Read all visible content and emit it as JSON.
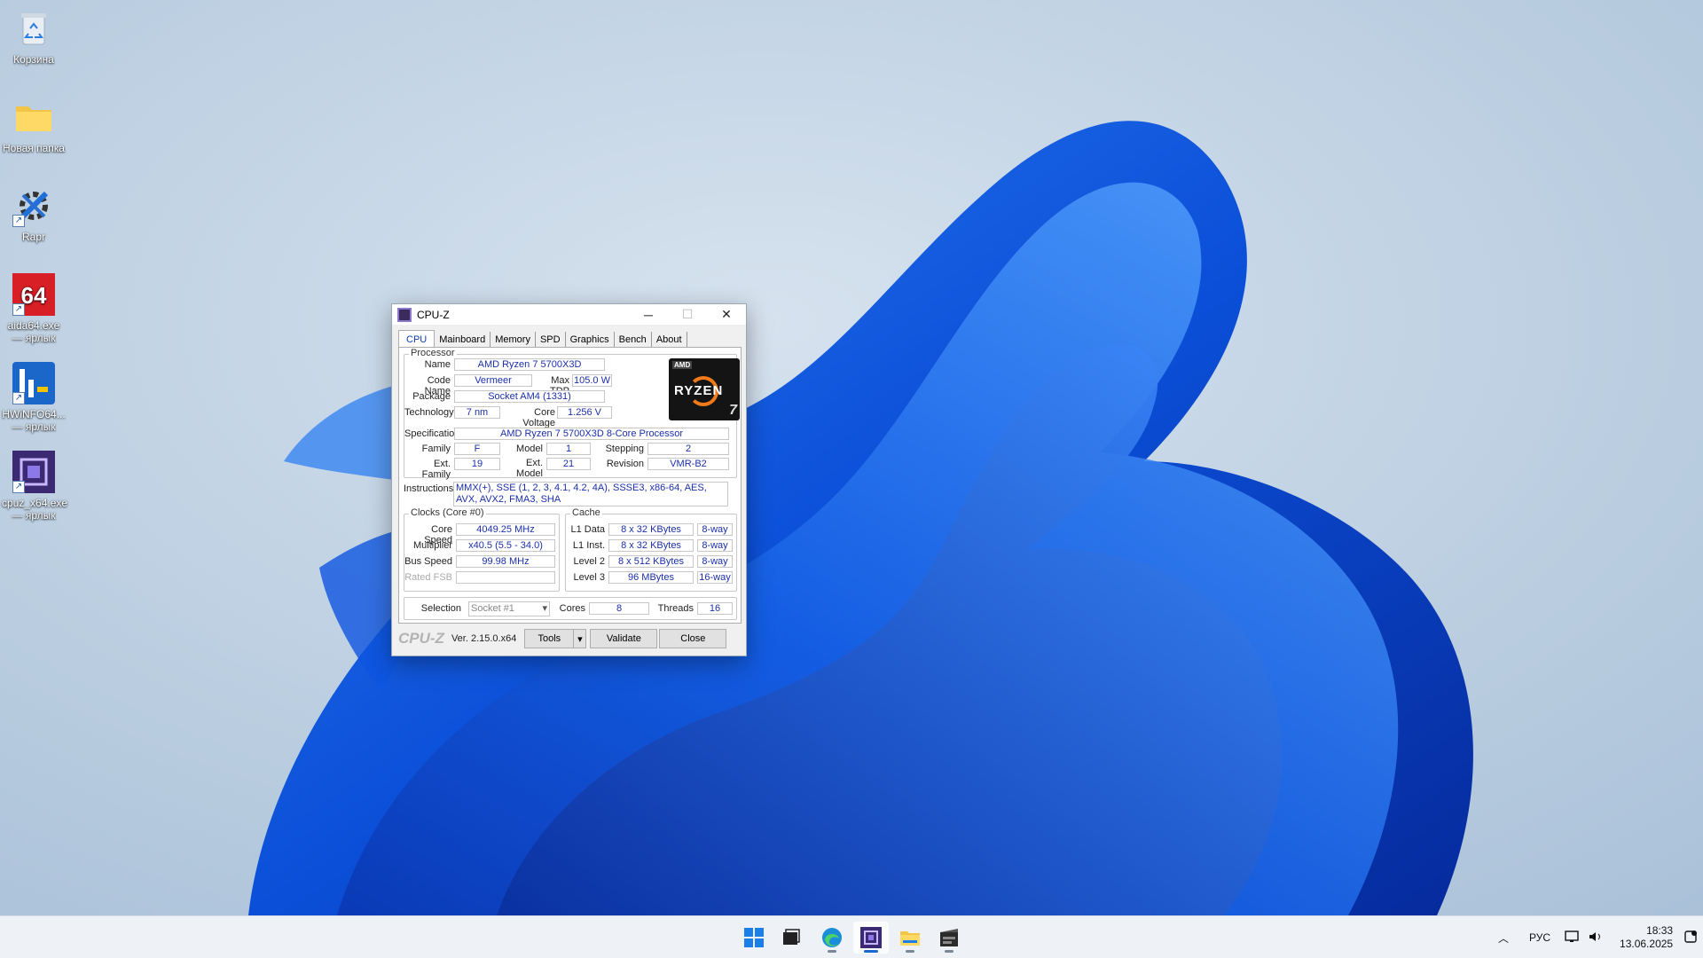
{
  "desktop": {
    "icons": [
      {
        "label": "Корзина",
        "icon": "recycle-bin-icon"
      },
      {
        "label": "Новая папка",
        "icon": "folder-icon"
      },
      {
        "label": "Rapr",
        "icon": "tools-icon"
      },
      {
        "label": "aida64.exe — ярлык",
        "icon": "aida64-icon"
      },
      {
        "label": "HWiNFO64... — ярлык",
        "icon": "hwinfo-icon"
      },
      {
        "label": "cpuz_x64.exe — ярлык",
        "icon": "cpuz-icon"
      }
    ]
  },
  "cpuz": {
    "title": "CPU-Z",
    "tabs": [
      "CPU",
      "Mainboard",
      "Memory",
      "SPD",
      "Graphics",
      "Bench",
      "About"
    ],
    "processor": {
      "group_title": "Processor",
      "name_label": "Name",
      "name": "AMD Ryzen 7 5700X3D",
      "codename_label": "Code Name",
      "codename": "Vermeer",
      "maxtdp_label": "Max TDP",
      "maxtdp": "105.0 W",
      "package_label": "Package",
      "package": "Socket AM4 (1331)",
      "technology_label": "Technology",
      "technology": "7 nm",
      "corevoltage_label": "Core Voltage",
      "corevoltage": "1.256 V",
      "spec_label": "Specification",
      "spec": "AMD Ryzen 7 5700X3D 8-Core Processor",
      "family_label": "Family",
      "family": "F",
      "model_label": "Model",
      "model": "1",
      "stepping_label": "Stepping",
      "stepping": "2",
      "extfamily_label": "Ext. Family",
      "extfamily": "19",
      "extmodel_label": "Ext. Model",
      "extmodel": "21",
      "revision_label": "Revision",
      "revision": "VMR-B2",
      "instructions_label": "Instructions",
      "instructions": "MMX(+), SSE (1, 2, 3, 4.1, 4.2, 4A), SSSE3, x86-64, AES, AVX, AVX2, FMA3, SHA",
      "logo_brand": "AMD",
      "logo_name": "RYZEN",
      "logo_tier": "7"
    },
    "clocks": {
      "group_title": "Clocks (Core #0)",
      "corespeed_label": "Core Speed",
      "corespeed": "4049.25 MHz",
      "multiplier_label": "Multiplier",
      "multiplier": "x40.5 (5.5 - 34.0)",
      "busspeed_label": "Bus Speed",
      "busspeed": "99.98 MHz",
      "ratedfsb_label": "Rated FSB",
      "ratedfsb": ""
    },
    "cache": {
      "group_title": "Cache",
      "rows": [
        {
          "label": "L1 Data",
          "size": "8 x 32 KBytes",
          "way": "8-way"
        },
        {
          "label": "L1 Inst.",
          "size": "8 x 32 KBytes",
          "way": "8-way"
        },
        {
          "label": "Level 2",
          "size": "8 x 512 KBytes",
          "way": "8-way"
        },
        {
          "label": "Level 3",
          "size": "96 MBytes",
          "way": "16-way"
        }
      ]
    },
    "selection": {
      "label": "Selection",
      "value": "Socket #1",
      "cores_label": "Cores",
      "cores": "8",
      "threads_label": "Threads",
      "threads": "16"
    },
    "footer": {
      "brand": "CPU-Z",
      "version": "Ver. 2.15.0.x64",
      "tools": "Tools",
      "validate": "Validate",
      "close": "Close"
    }
  },
  "taskbar": {
    "apps": [
      "start-icon",
      "task-view-icon",
      "edge-icon",
      "cpuz-icon",
      "file-explorer-icon",
      "media-app-icon"
    ],
    "language": "РУС",
    "time": "18:33",
    "date": "13.06.2025"
  },
  "colors": {
    "accent": "#1a66d2",
    "value_text": "#1b2fa8"
  }
}
